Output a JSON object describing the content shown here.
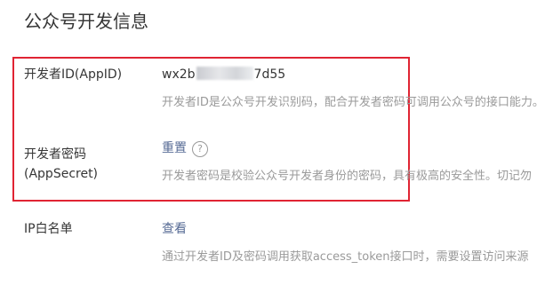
{
  "page": {
    "title": "公众号开发信息"
  },
  "appid": {
    "label": "开发者ID(AppID)",
    "value_prefix": "wx2b",
    "value_suffix": "7d55",
    "description": "开发者ID是公众号开发识别码，配合开发者密码可调用公众号的接口能力。"
  },
  "appsecret": {
    "label_line1": "开发者密码",
    "label_line2": "(AppSecret)",
    "reset_link": "重置",
    "help_glyph": "?",
    "help_icon": "question-circle-icon",
    "description": "开发者密码是校验公众号开发者身份的密码，具有极高的安全性。切记勿"
  },
  "ip_whitelist": {
    "label": "IP白名单",
    "view_link": "查看",
    "description": "通过开发者ID及密码调用获取access_token接口时，需要设置访问来源"
  },
  "colors": {
    "highlight_border": "#e02433",
    "link": "#576b95",
    "muted_text": "#9a9a9a"
  }
}
